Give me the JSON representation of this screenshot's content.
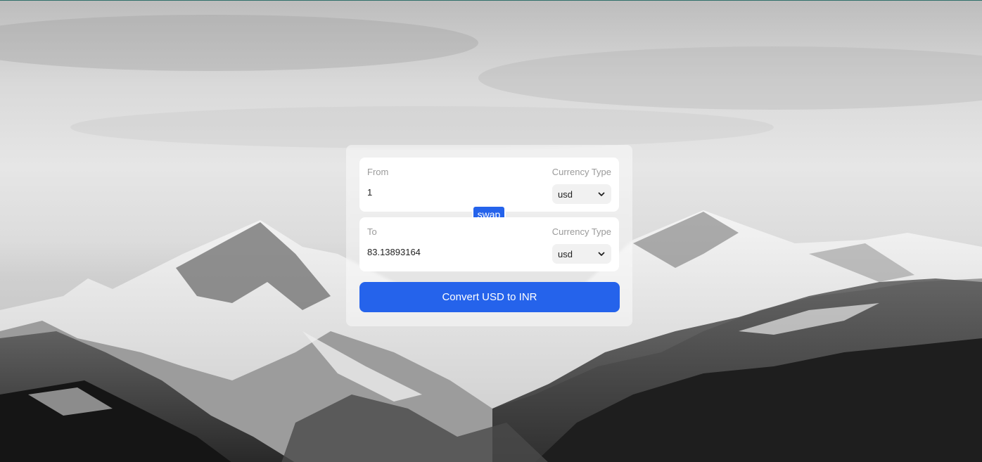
{
  "background": {
    "description_icon": "snowy-mountains-background"
  },
  "from": {
    "label": "From",
    "currency_type_label": "Currency Type",
    "amount": "1",
    "currency": "usd"
  },
  "swap": {
    "label": "swap"
  },
  "to": {
    "label": "To",
    "currency_type_label": "Currency Type",
    "amount": "83.13893164",
    "currency": "usd"
  },
  "convert": {
    "label": "Convert USD to INR"
  },
  "colors": {
    "accent": "#2563eb",
    "panel": "#ffffff",
    "muted_text": "#9a9a9a"
  }
}
